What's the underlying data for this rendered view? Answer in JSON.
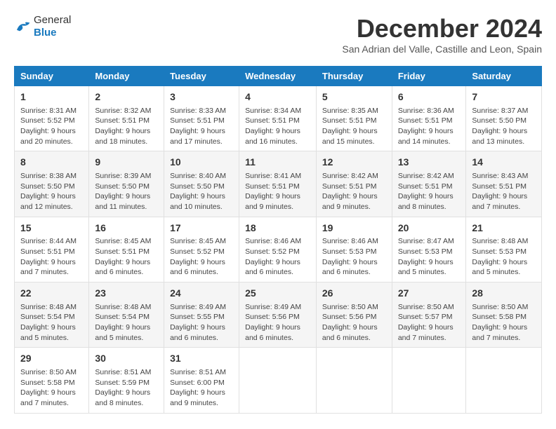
{
  "header": {
    "logo_general": "General",
    "logo_blue": "Blue",
    "title": "December 2024",
    "subtitle": "San Adrian del Valle, Castille and Leon, Spain"
  },
  "columns": [
    "Sunday",
    "Monday",
    "Tuesday",
    "Wednesday",
    "Thursday",
    "Friday",
    "Saturday"
  ],
  "weeks": [
    [
      {
        "day": "1",
        "info": "Sunrise: 8:31 AM\nSunset: 5:52 PM\nDaylight: 9 hours\nand 20 minutes."
      },
      {
        "day": "2",
        "info": "Sunrise: 8:32 AM\nSunset: 5:51 PM\nDaylight: 9 hours\nand 18 minutes."
      },
      {
        "day": "3",
        "info": "Sunrise: 8:33 AM\nSunset: 5:51 PM\nDaylight: 9 hours\nand 17 minutes."
      },
      {
        "day": "4",
        "info": "Sunrise: 8:34 AM\nSunset: 5:51 PM\nDaylight: 9 hours\nand 16 minutes."
      },
      {
        "day": "5",
        "info": "Sunrise: 8:35 AM\nSunset: 5:51 PM\nDaylight: 9 hours\nand 15 minutes."
      },
      {
        "day": "6",
        "info": "Sunrise: 8:36 AM\nSunset: 5:51 PM\nDaylight: 9 hours\nand 14 minutes."
      },
      {
        "day": "7",
        "info": "Sunrise: 8:37 AM\nSunset: 5:50 PM\nDaylight: 9 hours\nand 13 minutes."
      }
    ],
    [
      {
        "day": "8",
        "info": "Sunrise: 8:38 AM\nSunset: 5:50 PM\nDaylight: 9 hours\nand 12 minutes."
      },
      {
        "day": "9",
        "info": "Sunrise: 8:39 AM\nSunset: 5:50 PM\nDaylight: 9 hours\nand 11 minutes."
      },
      {
        "day": "10",
        "info": "Sunrise: 8:40 AM\nSunset: 5:50 PM\nDaylight: 9 hours\nand 10 minutes."
      },
      {
        "day": "11",
        "info": "Sunrise: 8:41 AM\nSunset: 5:51 PM\nDaylight: 9 hours\nand 9 minutes."
      },
      {
        "day": "12",
        "info": "Sunrise: 8:42 AM\nSunset: 5:51 PM\nDaylight: 9 hours\nand 9 minutes."
      },
      {
        "day": "13",
        "info": "Sunrise: 8:42 AM\nSunset: 5:51 PM\nDaylight: 9 hours\nand 8 minutes."
      },
      {
        "day": "14",
        "info": "Sunrise: 8:43 AM\nSunset: 5:51 PM\nDaylight: 9 hours\nand 7 minutes."
      }
    ],
    [
      {
        "day": "15",
        "info": "Sunrise: 8:44 AM\nSunset: 5:51 PM\nDaylight: 9 hours\nand 7 minutes."
      },
      {
        "day": "16",
        "info": "Sunrise: 8:45 AM\nSunset: 5:51 PM\nDaylight: 9 hours\nand 6 minutes."
      },
      {
        "day": "17",
        "info": "Sunrise: 8:45 AM\nSunset: 5:52 PM\nDaylight: 9 hours\nand 6 minutes."
      },
      {
        "day": "18",
        "info": "Sunrise: 8:46 AM\nSunset: 5:52 PM\nDaylight: 9 hours\nand 6 minutes."
      },
      {
        "day": "19",
        "info": "Sunrise: 8:46 AM\nSunset: 5:53 PM\nDaylight: 9 hours\nand 6 minutes."
      },
      {
        "day": "20",
        "info": "Sunrise: 8:47 AM\nSunset: 5:53 PM\nDaylight: 9 hours\nand 5 minutes."
      },
      {
        "day": "21",
        "info": "Sunrise: 8:48 AM\nSunset: 5:53 PM\nDaylight: 9 hours\nand 5 minutes."
      }
    ],
    [
      {
        "day": "22",
        "info": "Sunrise: 8:48 AM\nSunset: 5:54 PM\nDaylight: 9 hours\nand 5 minutes."
      },
      {
        "day": "23",
        "info": "Sunrise: 8:48 AM\nSunset: 5:54 PM\nDaylight: 9 hours\nand 5 minutes."
      },
      {
        "day": "24",
        "info": "Sunrise: 8:49 AM\nSunset: 5:55 PM\nDaylight: 9 hours\nand 6 minutes."
      },
      {
        "day": "25",
        "info": "Sunrise: 8:49 AM\nSunset: 5:56 PM\nDaylight: 9 hours\nand 6 minutes."
      },
      {
        "day": "26",
        "info": "Sunrise: 8:50 AM\nSunset: 5:56 PM\nDaylight: 9 hours\nand 6 minutes."
      },
      {
        "day": "27",
        "info": "Sunrise: 8:50 AM\nSunset: 5:57 PM\nDaylight: 9 hours\nand 7 minutes."
      },
      {
        "day": "28",
        "info": "Sunrise: 8:50 AM\nSunset: 5:58 PM\nDaylight: 9 hours\nand 7 minutes."
      }
    ],
    [
      {
        "day": "29",
        "info": "Sunrise: 8:50 AM\nSunset: 5:58 PM\nDaylight: 9 hours\nand 7 minutes."
      },
      {
        "day": "30",
        "info": "Sunrise: 8:51 AM\nSunset: 5:59 PM\nDaylight: 9 hours\nand 8 minutes."
      },
      {
        "day": "31",
        "info": "Sunrise: 8:51 AM\nSunset: 6:00 PM\nDaylight: 9 hours\nand 9 minutes."
      },
      {
        "day": "",
        "info": ""
      },
      {
        "day": "",
        "info": ""
      },
      {
        "day": "",
        "info": ""
      },
      {
        "day": "",
        "info": ""
      }
    ]
  ]
}
